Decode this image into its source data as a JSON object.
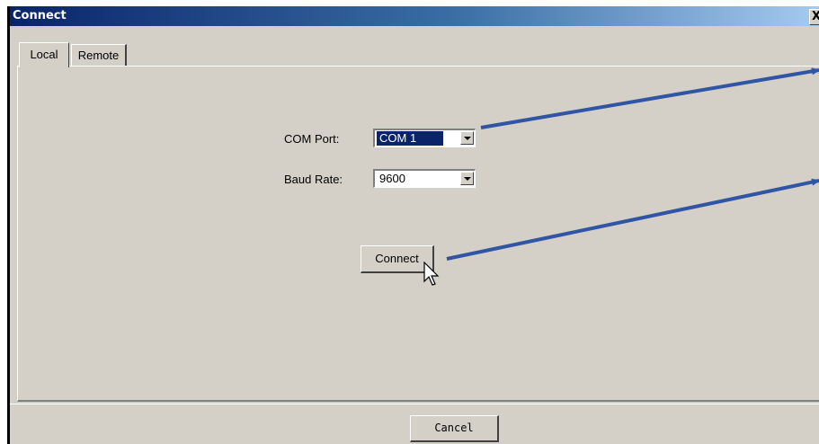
{
  "window": {
    "title": "Connect",
    "close_glyph": "X"
  },
  "tabs": [
    {
      "label": "Local",
      "active": true
    },
    {
      "label": "Remote",
      "active": false
    }
  ],
  "form": {
    "com_port": {
      "label": "COM Port:",
      "value": "COM 1"
    },
    "baud_rate": {
      "label": "Baud Rate:",
      "value": "9600"
    },
    "connect_label": "Connect"
  },
  "footer": {
    "cancel_label": "Cancel"
  },
  "icons": {
    "dropdown": "chevron-down-icon",
    "cursor": "mouse-pointer-icon"
  },
  "colors": {
    "annotation_arrow": "#2f55a4",
    "titlebar": "#0a246a",
    "face": "#d4d0c8",
    "selection": "#0a246a"
  }
}
